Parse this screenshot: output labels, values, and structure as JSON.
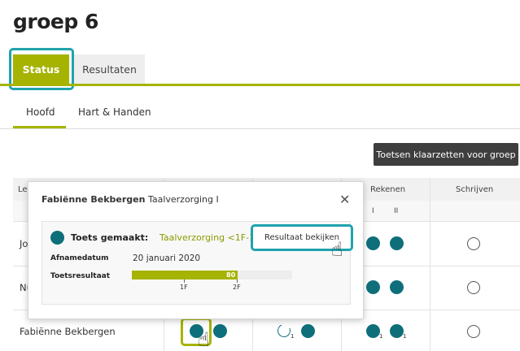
{
  "header": {
    "title": "groep 6"
  },
  "main_tabs": [
    {
      "label": "Status",
      "active": true
    },
    {
      "label": "Resultaten",
      "active": false
    }
  ],
  "sub_tabs": [
    {
      "label": "Hoofd",
      "active": true
    },
    {
      "label": "Hart & Handen",
      "active": false
    }
  ],
  "actions": {
    "klaarzetten_label": "Toetsen klaarzetten voor groep"
  },
  "table": {
    "columns": {
      "first_partial": "Le",
      "rekenen": "Rekenen",
      "schrijven": "Schrijven"
    },
    "rekenen_sub": [
      "I",
      "II"
    ],
    "rows": [
      {
        "name": "Jo"
      },
      {
        "name": "Nu"
      },
      {
        "name": "Fabiënne Bekbergen",
        "sub_marks": [
          "1",
          "1",
          "1"
        ]
      }
    ]
  },
  "popup": {
    "student_name": "Fabiënne Bekbergen",
    "subject": "Taalverzorging I",
    "close_icon": "✕",
    "toets_label": "Toets gemaakt:",
    "toets_value": "Taalverzorging <1F-1F-2F",
    "resultaat_button": "Resultaat bekijken",
    "afname_label": "Afnamedatum",
    "afname_value": "20 januari 2020",
    "result_label": "Toetsresultaat",
    "result_score": "80",
    "result_fraction": 0.66,
    "bar_ticks": [
      "1F",
      "2F"
    ]
  },
  "colors": {
    "accent": "#a6b300",
    "highlight": "#1fa3ad",
    "dot": "#0e6f7a",
    "dark_button": "#3e3e3e"
  },
  "icons": {
    "pointer": "hand-pointer-icon",
    "close": "close-icon",
    "retry": "circular-arrow-icon"
  }
}
